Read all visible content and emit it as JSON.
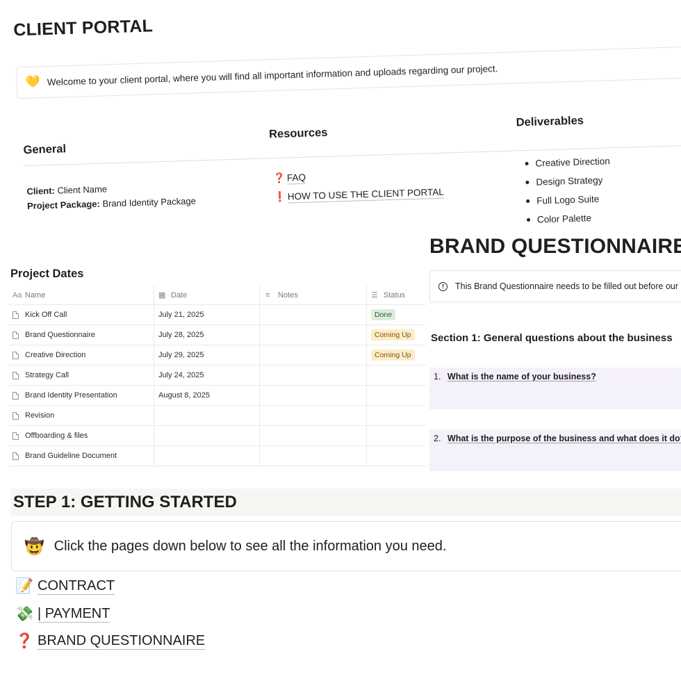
{
  "portal": {
    "title": "CLIENT PORTAL",
    "welcome_icon": "💛",
    "welcome_text": "Welcome to your client portal, where you will find all important information and uploads regarding our project."
  },
  "general": {
    "heading": "General",
    "client_label": "Client:",
    "client_value": "Client Name",
    "package_label": "Project Package:",
    "package_value": "Brand Identity Package"
  },
  "resources": {
    "heading": "Resources",
    "items": [
      {
        "icon": "❓",
        "label": "FAQ"
      },
      {
        "icon": "❗",
        "label": "HOW TO USE THE CLIENT PORTAL"
      }
    ]
  },
  "deliverables": {
    "heading": "Deliverables",
    "items": [
      "Creative Direction",
      "Design Strategy",
      "Full Logo Suite",
      "Color Palette"
    ]
  },
  "project_dates": {
    "title": "Project Dates",
    "columns": {
      "name": "Name",
      "name_icon": "Aa",
      "date": "Date",
      "date_icon": "▦",
      "notes": "Notes",
      "notes_icon": "≡",
      "status": "Status",
      "status_icon": "☰"
    },
    "rows": [
      {
        "name": "Kick Off Call",
        "date": "July 21, 2025",
        "notes": "",
        "status": "Done"
      },
      {
        "name": "Brand Questionnaire",
        "date": "July 28, 2025",
        "notes": "",
        "status": "Coming Up"
      },
      {
        "name": "Creative Direction",
        "date": "July 29, 2025",
        "notes": "",
        "status": "Coming Up"
      },
      {
        "name": "Strategy Call",
        "date": "July 24, 2025",
        "notes": "",
        "status": ""
      },
      {
        "name": "Brand Identity Presentation",
        "date": "August 8, 2025",
        "notes": "",
        "status": ""
      },
      {
        "name": "Revision",
        "date": "",
        "notes": "",
        "status": ""
      },
      {
        "name": "Offboarding & files",
        "date": "",
        "notes": "",
        "status": ""
      },
      {
        "name": "Brand Guideline Document",
        "date": "",
        "notes": "",
        "status": ""
      }
    ],
    "status_colors": {
      "Done": "#dbeddb",
      "Coming Up": "#fdecc8"
    }
  },
  "questionnaire": {
    "title": "BRAND QUESTIONNAIRE",
    "callout_icon": "!",
    "callout_text": "This Brand Questionnaire needs to be filled out before our",
    "section_title": "Section 1: General questions about the business",
    "questions": [
      {
        "num": "1.",
        "text": "What is the name of your business?"
      },
      {
        "num": "2.",
        "text": "What is the purpose of the business and what does it do?"
      }
    ]
  },
  "step1": {
    "heading": "STEP 1: GETTING STARTED",
    "callout_icon": "🤠",
    "callout_text": "Click the pages down below to see all the information you need.",
    "pages": [
      {
        "icon": "📝",
        "label": "CONTRACT"
      },
      {
        "icon": "💸",
        "label": "| PAYMENT"
      },
      {
        "icon": "❓",
        "label": "BRAND QUESTIONNAIRE"
      }
    ]
  }
}
